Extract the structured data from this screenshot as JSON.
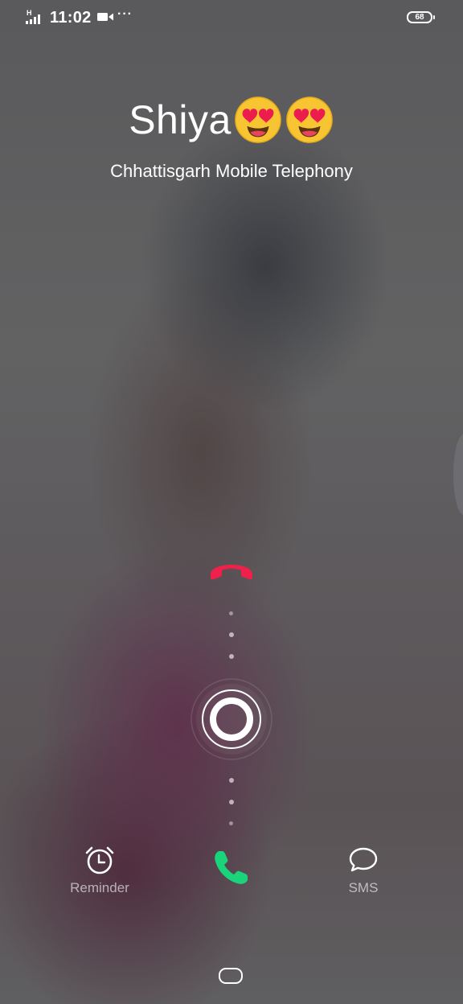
{
  "status_bar": {
    "network_type": "H",
    "time": "11:02",
    "battery_level": "68"
  },
  "caller": {
    "name": "Shiya",
    "emojis": [
      "heart-eyes-emoji",
      "heart-eyes-emoji"
    ],
    "carrier": "Chhattisgarh Mobile Telephony"
  },
  "actions": {
    "reminder_label": "Reminder",
    "sms_label": "SMS"
  },
  "colors": {
    "decline": "#f0204a",
    "accept": "#19d47a",
    "text": "#ffffff"
  }
}
